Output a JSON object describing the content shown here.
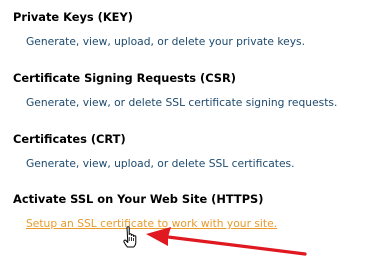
{
  "sections": [
    {
      "title": "Private Keys (KEY)",
      "description": "Generate, view, upload, or delete your private keys."
    },
    {
      "title": "Certificate Signing Requests (CSR)",
      "description": "Generate, view, or delete SSL certificate signing requests."
    },
    {
      "title": "Certificates (CRT)",
      "description": "Generate, view, upload, or delete SSL certificates."
    },
    {
      "title": "Activate SSL on Your Web Site (HTTPS)",
      "link": "Setup an SSL certificate to work with your site."
    }
  ],
  "colors": {
    "title": "#000000",
    "description": "#1d4a6e",
    "link": "#e89a2c",
    "arrow": "#e0181f"
  },
  "annotation": {
    "arrow_icon": "red-arrow-icon",
    "cursor_icon": "hand-pointer-icon"
  }
}
